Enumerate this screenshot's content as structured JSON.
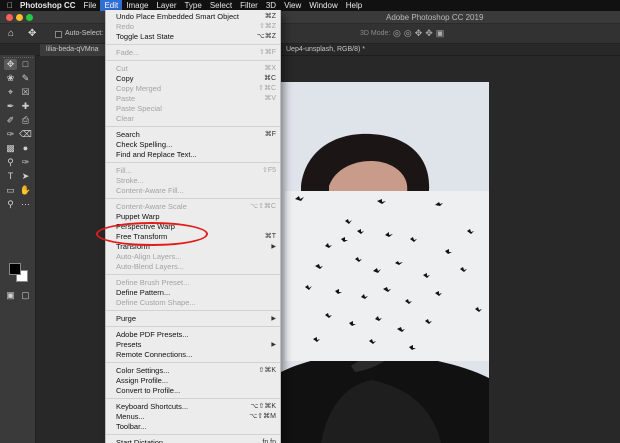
{
  "menubar": {
    "app_name": "Photoshop CC",
    "items": [
      "File",
      "Edit",
      "Image",
      "Layer",
      "Type",
      "Select",
      "Filter",
      "3D",
      "View",
      "Window",
      "Help"
    ]
  },
  "window": {
    "title": "Adobe Photoshop CC 2019"
  },
  "options_bar": {
    "auto_select_label": "Auto-Select:",
    "mode_3d_label": "3D Mode:"
  },
  "tabs": {
    "tab1_label": "lilia-beda-qVMna",
    "tab2_label": "Uep4-unsplash, RGB/8) *"
  },
  "edit_menu": {
    "items": [
      {
        "label": "Undo Place Embedded Smart Object",
        "shortcut": "⌘Z",
        "enabled": true
      },
      {
        "label": "Redo",
        "shortcut": "⇧⌘Z",
        "enabled": false
      },
      {
        "label": "Toggle Last State",
        "shortcut": "⌥⌘Z",
        "enabled": true
      },
      {
        "label": "Fade...",
        "shortcut": "⇧⌘F",
        "enabled": false
      },
      {
        "label": "Cut",
        "shortcut": "⌘X",
        "enabled": false
      },
      {
        "label": "Copy",
        "shortcut": "⌘C",
        "enabled": true
      },
      {
        "label": "Copy Merged",
        "shortcut": "⇧⌘C",
        "enabled": false
      },
      {
        "label": "Paste",
        "shortcut": "⌘V",
        "enabled": false
      },
      {
        "label": "Paste Special",
        "shortcut": "",
        "enabled": false
      },
      {
        "label": "Clear",
        "shortcut": "",
        "enabled": false
      },
      {
        "label": "Search",
        "shortcut": "⌘F",
        "enabled": true
      },
      {
        "label": "Check Spelling...",
        "shortcut": "",
        "enabled": true
      },
      {
        "label": "Find and Replace Text...",
        "shortcut": "",
        "enabled": true
      },
      {
        "label": "Fill...",
        "shortcut": "⇧F5",
        "enabled": false
      },
      {
        "label": "Stroke...",
        "shortcut": "",
        "enabled": false
      },
      {
        "label": "Content-Aware Fill...",
        "shortcut": "",
        "enabled": false
      },
      {
        "label": "Content-Aware Scale",
        "shortcut": "⌥⇧⌘C",
        "enabled": false
      },
      {
        "label": "Puppet Warp",
        "shortcut": "",
        "enabled": true
      },
      {
        "label": "Perspective Warp",
        "shortcut": "",
        "enabled": true
      },
      {
        "label": "Free Transform",
        "shortcut": "⌘T",
        "enabled": true
      },
      {
        "label": "Transform",
        "shortcut": "",
        "enabled": true,
        "submenu": true
      },
      {
        "label": "Auto-Align Layers...",
        "shortcut": "",
        "enabled": false
      },
      {
        "label": "Auto-Blend Layers...",
        "shortcut": "",
        "enabled": false
      },
      {
        "label": "Define Brush Preset...",
        "shortcut": "",
        "enabled": false
      },
      {
        "label": "Define Pattern...",
        "shortcut": "",
        "enabled": true
      },
      {
        "label": "Define Custom Shape...",
        "shortcut": "",
        "enabled": false
      },
      {
        "label": "Purge",
        "shortcut": "",
        "enabled": true,
        "submenu": true
      },
      {
        "label": "Adobe PDF Presets...",
        "shortcut": "",
        "enabled": true
      },
      {
        "label": "Presets",
        "shortcut": "",
        "enabled": true,
        "submenu": true
      },
      {
        "label": "Remote Connections...",
        "shortcut": "",
        "enabled": true
      },
      {
        "label": "Color Settings...",
        "shortcut": "⇧⌘K",
        "enabled": true
      },
      {
        "label": "Assign Profile...",
        "shortcut": "",
        "enabled": true
      },
      {
        "label": "Convert to Profile...",
        "shortcut": "",
        "enabled": true
      },
      {
        "label": "Keyboard Shortcuts...",
        "shortcut": "⌥⇧⌘K",
        "enabled": true
      },
      {
        "label": "Menus...",
        "shortcut": "⌥⇧⌘M",
        "enabled": true
      },
      {
        "label": "Toolbar...",
        "shortcut": "",
        "enabled": true
      },
      {
        "label": "Start Dictation...",
        "shortcut": "fn fn",
        "enabled": true
      }
    ]
  },
  "colors": {
    "menu_highlight": "#2f6fd6",
    "annotation": "#e21b1b"
  }
}
